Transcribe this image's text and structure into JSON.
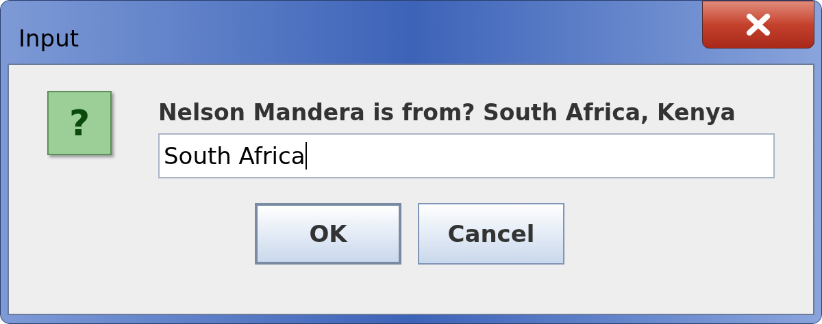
{
  "window": {
    "title": "Input"
  },
  "message": {
    "icon_symbol": "?",
    "text": "Nelson Mandera is from? South Africa, Kenya"
  },
  "input": {
    "value": "South Africa",
    "focused": true
  },
  "buttons": [
    {
      "label": "OK",
      "default": true
    },
    {
      "label": "Cancel",
      "default": false
    }
  ]
}
